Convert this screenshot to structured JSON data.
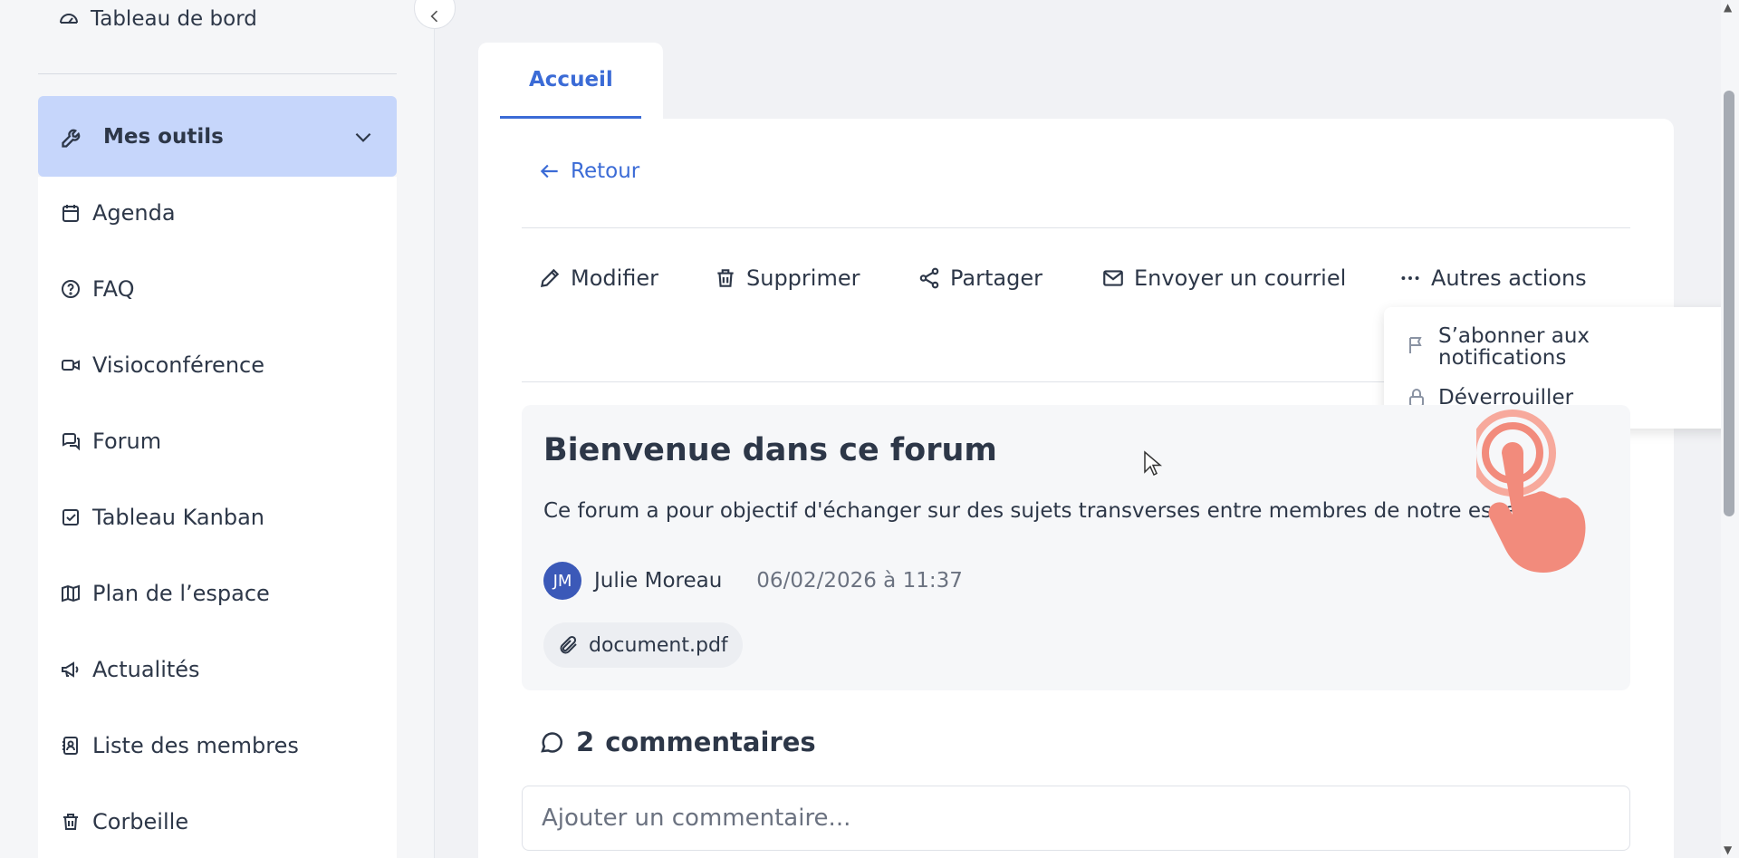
{
  "sidebar": {
    "top_item": "Tableau de bord",
    "tools_label": "Mes outils",
    "items": [
      {
        "label": "Agenda"
      },
      {
        "label": "FAQ"
      },
      {
        "label": "Visioconférence"
      },
      {
        "label": "Forum"
      },
      {
        "label": "Tableau Kanban"
      },
      {
        "label": "Plan de l’espace"
      },
      {
        "label": "Actualités"
      },
      {
        "label": "Liste des membres"
      },
      {
        "label": "Corbeille"
      }
    ]
  },
  "tabs": [
    {
      "label": "Accueil"
    }
  ],
  "back_label": "Retour",
  "toolbar": {
    "edit": "Modifier",
    "delete": "Supprimer",
    "share": "Partager",
    "email": "Envoyer un courriel",
    "more": "Autres actions"
  },
  "dropdown": {
    "subscribe_line1": "S’abonner aux",
    "subscribe_line2": "notifications",
    "unlock": "Déverrouiller"
  },
  "post": {
    "title": "Bienvenue dans ce forum",
    "description": "Ce forum a pour objectif d'échanger sur des sujets transverses entre membres de notre espace.",
    "author_initials": "JM",
    "author_name": "Julie Moreau",
    "date": "06/02/2026 à 11:37",
    "attachment": "document.pdf"
  },
  "comments": {
    "count": "2",
    "label": "commentaires",
    "placeholder": "Ajouter un commentaire..."
  },
  "colors": {
    "accent": "#3b6bd6",
    "tools_bg": "#c6d6fb",
    "avatar_bg": "#3b59b8",
    "hand": "#f28b7c"
  }
}
